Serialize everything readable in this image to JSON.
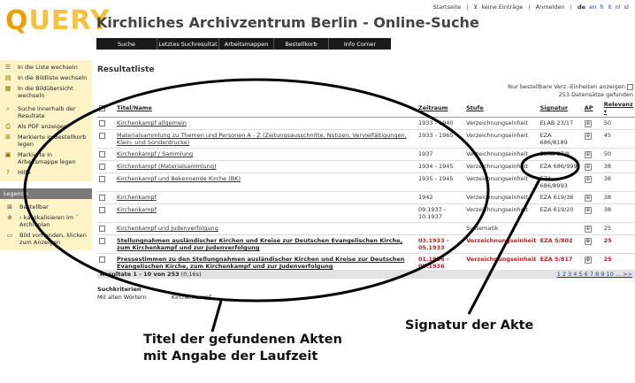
{
  "header": {
    "logo_q": "Q",
    "logo_rest": "UERY",
    "site_title": "Kirchliches Archivzentrum Berlin - Online-Suche",
    "topnav": {
      "startseite": "Startseite",
      "keine_eintraege": "keine Einträge",
      "anmelden": "Anmelden",
      "langs": [
        "de",
        "en",
        "fr",
        "it",
        "nl",
        "sl"
      ]
    },
    "nav": [
      "Suche",
      "Letztes Suchresultat",
      "Arbeitsmappen",
      "Bestellkorb",
      "Info Corner"
    ]
  },
  "sidebar": {
    "items": [
      {
        "icon": "list-icon",
        "label": "In die Liste wechseln"
      },
      {
        "icon": "image-list-icon",
        "label": "In die Bildliste wechseln"
      },
      {
        "icon": "image-overview-icon",
        "label": "In die Bildübersicht wechseln"
      },
      {
        "icon": "search-in-results-icon",
        "label": "Suche innerhalb der Resultate"
      },
      {
        "icon": "pdf-icon",
        "label": "Als PDF anzeigen"
      },
      {
        "icon": "order-basket-icon",
        "label": "Markierte in Bestellkorb legen"
      },
      {
        "icon": "workfolder-icon",
        "label": "Markierte in Arbeitsmappe legen"
      },
      {
        "icon": "help-icon",
        "label": "Hilfe"
      }
    ],
    "legend_title": "Legende",
    "legend": [
      {
        "icon": "orderable-icon",
        "label": "Bestellbar"
      },
      {
        "icon": "locate-icon",
        "label": "› kaLokalisieren im ´ Archivplan"
      },
      {
        "icon": "image-available-icon",
        "label": "Bild vorhanden, klicken zum Anzeigen"
      }
    ]
  },
  "main": {
    "heading": "Resultatliste",
    "filter_label": "Nur bestellbare Verz.-Einheiten anzeigen",
    "count_label": "253 Datensätze gefunden",
    "columns": {
      "title": "Titel/Name",
      "period": "Zeitraum",
      "level": "Stufe",
      "signature": "Signatur",
      "ap": "AP",
      "relevance": "Relevanz"
    },
    "rows": [
      {
        "title": "Kirchenkampf allgemein",
        "period": "1933 - 1940",
        "level": "Verzeichnungseinheit",
        "signature": "ELAB 23/17",
        "relevance": "50",
        "red": false
      },
      {
        "title": "Materialsammlung zu Themen und Personen A - Z (Zeitungsausschnitte, Notizen, Vervielfältigungen, Klein- und Sonderdrucke)",
        "period": "1933 - 1965",
        "level": "Verzeichnungseinheit",
        "signature": "EZA 686/8189",
        "relevance": "45",
        "red": false
      },
      {
        "title": "Kirchenkampf / Sammlung",
        "period": "1937",
        "level": "Verzeichnungseinheit",
        "signature": "ELAB 37/8",
        "relevance": "50",
        "red": false
      },
      {
        "title": "Kirchenkampf (Materialsammlung)",
        "period": "1934 - 1945",
        "level": "Verzeichnungseinheit",
        "signature": "EZA 686/999",
        "relevance": "38",
        "red": false
      },
      {
        "title": "Kirchenkampf und Bekennende Kirche (BK)",
        "period": "1935 - 1945",
        "level": "Verzeichnungseinheit",
        "signature": "EZA 686/8993",
        "relevance": "38",
        "red": false
      },
      {
        "title": "Kirchenkampf",
        "period": "1942",
        "level": "Verzeichnungseinheit",
        "signature": "EZA 619/36",
        "relevance": "38",
        "red": false
      },
      {
        "title": "Kirchenkampf",
        "period": "09.1937 - 10.1937",
        "level": "Verzeichnungseinheit",
        "signature": "EZA 619/20",
        "relevance": "38",
        "red": false
      },
      {
        "title": "Kirchenkampf und Judenverfolgung",
        "period": "",
        "level": "Systematik",
        "signature": "",
        "relevance": "25",
        "red": false
      },
      {
        "title": "Stellungnahmen ausländischer Kirchen und Kreise zur Deutschen Evangelischen Kirche, zum Kirchenkampf und zur Judenverfolgung",
        "period": "03.1933 - 05.1933",
        "level": "Verzeichnungseinheit",
        "signature": "EZA 5/802",
        "relevance": "25",
        "red": true
      },
      {
        "title": "Pressestimmen zu den Stellungnahmen ausländischer Kirchen und Kreise zur Deutschen Evangelischen Kirche, zum Kirchenkampf und zur Judenverfolgung",
        "period": "01.1936 - 09.1936",
        "level": "Verzeichnungseinheit",
        "signature": "EZA 5/817",
        "relevance": "25",
        "red": true
      }
    ],
    "result_info": "Resultate 1 - 10 von 253",
    "result_time": "(0,16s)",
    "pages": "1 2 3 4 5 6 7 8 9 10 ... >>",
    "criteria_heading": "Suchkriterien",
    "criteria_label": "Mit allen Wörtern",
    "criteria_value": "Kirchenkampf"
  },
  "annotations": {
    "titles_line1": "Titel der gefundenen Akten",
    "titles_line2": "mit Angabe der Laufzeit",
    "signature": "Signatur der Akte"
  }
}
